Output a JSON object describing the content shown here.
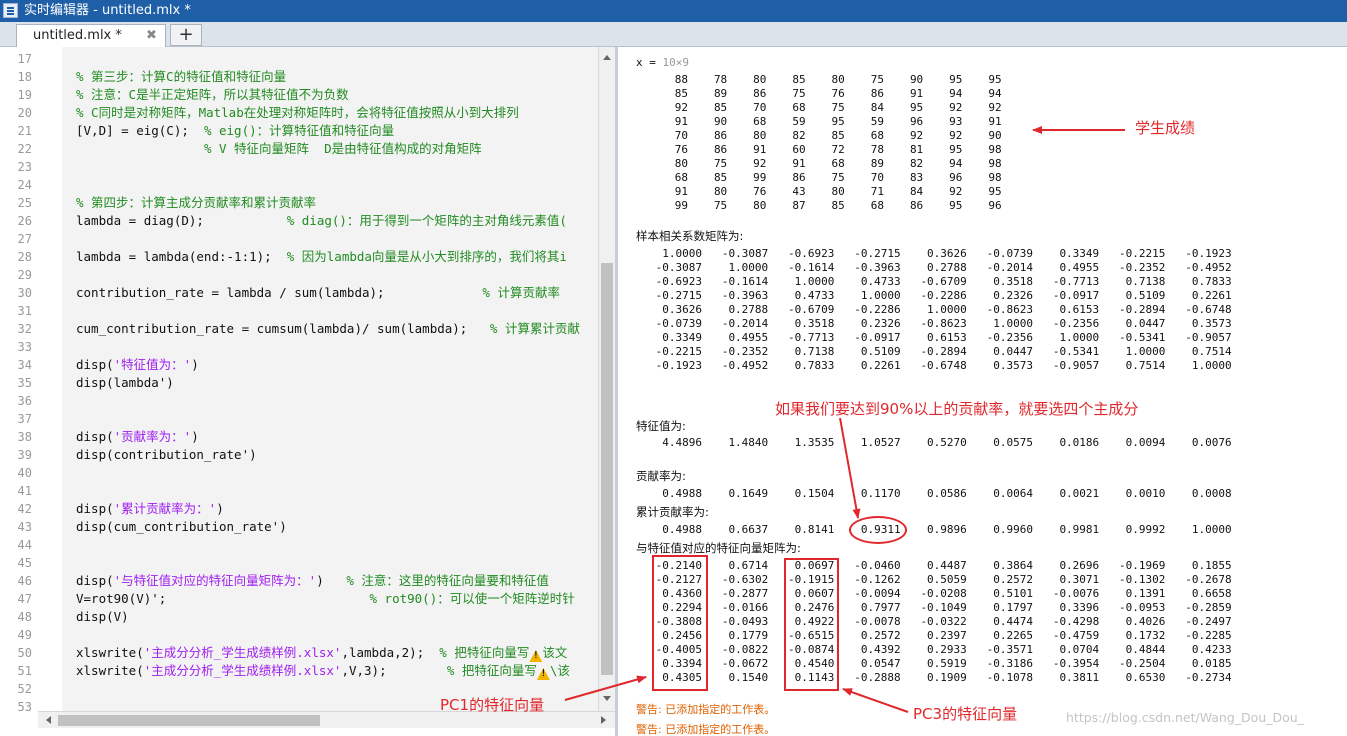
{
  "window": {
    "title": "实时编辑器 - untitled.mlx *"
  },
  "tabs": [
    {
      "label": "untitled.mlx *",
      "close": "✖"
    }
  ],
  "tab_add": "+",
  "editor": {
    "line_numbers": [
      "17",
      "18",
      "19",
      "20",
      "21",
      "22",
      "23",
      "24",
      "25",
      "26",
      "27",
      "28",
      "29",
      "30",
      "31",
      "32",
      "33",
      "34",
      "35",
      "36",
      "37",
      "38",
      "39",
      "40",
      "41",
      "42",
      "43",
      "44",
      "45",
      "46",
      "47",
      "48",
      "49",
      "50",
      "51",
      "52",
      "53"
    ],
    "lines": [
      {
        "n": 18,
        "parts": [
          {
            "t": "% 第三步：计算C的特征值和特征向量",
            "c": "comment"
          }
        ]
      },
      {
        "n": 19,
        "parts": [
          {
            "t": "% 注意：C是半正定矩阵，所以其特征值不为负数",
            "c": "comment"
          }
        ]
      },
      {
        "n": 20,
        "parts": [
          {
            "t": "% C同时是对称矩阵，Matlab在处理对称矩阵时，会将特征值按照从小到大排列",
            "c": "comment"
          }
        ]
      },
      {
        "n": 21,
        "parts": [
          {
            "t": "[V,D] = eig(C);  ",
            "c": ""
          },
          {
            "t": "% eig()：计算特征值和特征向量",
            "c": "comment"
          }
        ]
      },
      {
        "n": 22,
        "parts": [
          {
            "t": "                 ",
            "c": ""
          },
          {
            "t": "% V 特征向量矩阵  D是由特征值构成的对角矩阵",
            "c": "comment"
          }
        ]
      },
      {
        "n": 25,
        "parts": [
          {
            "t": "% 第四步：计算主成分贡献率和累计贡献率",
            "c": "comment"
          }
        ]
      },
      {
        "n": 26,
        "parts": [
          {
            "t": "lambda = diag(D);           ",
            "c": ""
          },
          {
            "t": "% diag()：用于得到一个矩阵的主对角线元素值(",
            "c": "comment"
          }
        ]
      },
      {
        "n": 28,
        "parts": [
          {
            "t": "lambda = lambda(end:-1:1);  ",
            "c": ""
          },
          {
            "t": "% 因为lambda向量是从小大到排序的，我们将其i",
            "c": "comment"
          }
        ]
      },
      {
        "n": 30,
        "parts": [
          {
            "t": "contribution_rate = lambda / sum(lambda);             ",
            "c": ""
          },
          {
            "t": "% 计算贡献率",
            "c": "comment"
          }
        ]
      },
      {
        "n": 32,
        "parts": [
          {
            "t": "cum_contribution_rate = cumsum(lambda)/ sum(lambda);   ",
            "c": ""
          },
          {
            "t": "% 计算累计贡献",
            "c": "comment"
          }
        ]
      },
      {
        "n": 34,
        "parts": [
          {
            "t": "disp(",
            "c": ""
          },
          {
            "t": "'特征值为：'",
            "c": "str"
          },
          {
            "t": ")",
            "c": ""
          }
        ]
      },
      {
        "n": 35,
        "parts": [
          {
            "t": "disp(lambda')",
            "c": ""
          }
        ]
      },
      {
        "n": 38,
        "parts": [
          {
            "t": "disp(",
            "c": ""
          },
          {
            "t": "'贡献率为：'",
            "c": "str"
          },
          {
            "t": ")",
            "c": ""
          }
        ]
      },
      {
        "n": 39,
        "parts": [
          {
            "t": "disp(contribution_rate')",
            "c": ""
          }
        ]
      },
      {
        "n": 42,
        "parts": [
          {
            "t": "disp(",
            "c": ""
          },
          {
            "t": "'累计贡献率为：'",
            "c": "str"
          },
          {
            "t": ")",
            "c": ""
          }
        ]
      },
      {
        "n": 43,
        "parts": [
          {
            "t": "disp(cum_contribution_rate')",
            "c": ""
          }
        ]
      },
      {
        "n": 46,
        "parts": [
          {
            "t": "disp(",
            "c": ""
          },
          {
            "t": "'与特征值对应的特征向量矩阵为：'",
            "c": "str"
          },
          {
            "t": ")   ",
            "c": ""
          },
          {
            "t": "% 注意：这里的特征向量要和特征值",
            "c": "comment"
          }
        ]
      },
      {
        "n": 47,
        "parts": [
          {
            "t": "V=rot90(V)';                           ",
            "c": ""
          },
          {
            "t": "% rot90()：可以使一个矩阵逆时针",
            "c": "comment"
          }
        ]
      },
      {
        "n": 48,
        "parts": [
          {
            "t": "disp(V)",
            "c": ""
          }
        ]
      },
      {
        "n": 50,
        "parts": [
          {
            "t": "xlswrite(",
            "c": ""
          },
          {
            "t": "'主成分分析_学生成绩样例.xlsx'",
            "c": "str"
          },
          {
            "t": ",lambda,2);  ",
            "c": ""
          },
          {
            "t": "% 把特征向量写",
            "c": "comment"
          },
          {
            "t": "!",
            "c": "warn"
          },
          {
            "t": "该文",
            "c": "comment"
          }
        ]
      },
      {
        "n": 51,
        "parts": [
          {
            "t": "xlswrite(",
            "c": ""
          },
          {
            "t": "'主成分分析_学生成绩样例.xlsx'",
            "c": "str"
          },
          {
            "t": ",V,3);        ",
            "c": ""
          },
          {
            "t": "% 把特征向量写",
            "c": "comment"
          },
          {
            "t": "!",
            "c": "warn"
          },
          {
            "t": "\\该",
            "c": "comment"
          }
        ]
      }
    ]
  },
  "output": {
    "x_label": "x = ",
    "x_size": "10×9",
    "x_rows": [
      [
        "88",
        "78",
        "80",
        "85",
        "80",
        "75",
        "90",
        "95",
        "95"
      ],
      [
        "85",
        "89",
        "86",
        "75",
        "76",
        "86",
        "91",
        "94",
        "94"
      ],
      [
        "92",
        "85",
        "70",
        "68",
        "75",
        "84",
        "95",
        "92",
        "92"
      ],
      [
        "91",
        "90",
        "68",
        "59",
        "95",
        "59",
        "96",
        "93",
        "91"
      ],
      [
        "70",
        "86",
        "80",
        "82",
        "85",
        "68",
        "92",
        "92",
        "90"
      ],
      [
        "76",
        "86",
        "91",
        "60",
        "72",
        "78",
        "81",
        "95",
        "98"
      ],
      [
        "80",
        "75",
        "92",
        "91",
        "68",
        "89",
        "82",
        "94",
        "98"
      ],
      [
        "68",
        "85",
        "99",
        "86",
        "75",
        "70",
        "83",
        "96",
        "98"
      ],
      [
        "91",
        "80",
        "76",
        "43",
        "80",
        "71",
        "84",
        "92",
        "95"
      ],
      [
        "99",
        "75",
        "80",
        "87",
        "85",
        "68",
        "86",
        "95",
        "96"
      ]
    ],
    "corr_label": "样本相关系数矩阵为:",
    "corr_rows": [
      [
        "1.0000",
        "-0.3087",
        "-0.6923",
        "-0.2715",
        "0.3626",
        "-0.0739",
        "0.3349",
        "-0.2215",
        "-0.1923"
      ],
      [
        "-0.3087",
        "1.0000",
        "-0.1614",
        "-0.3963",
        "0.2788",
        "-0.2014",
        "0.4955",
        "-0.2352",
        "-0.4952"
      ],
      [
        "-0.6923",
        "-0.1614",
        "1.0000",
        "0.4733",
        "-0.6709",
        "0.3518",
        "-0.7713",
        "0.7138",
        "0.7833"
      ],
      [
        "-0.2715",
        "-0.3963",
        "0.4733",
        "1.0000",
        "-0.2286",
        "0.2326",
        "-0.0917",
        "0.5109",
        "0.2261"
      ],
      [
        "0.3626",
        "0.2788",
        "-0.6709",
        "-0.2286",
        "1.0000",
        "-0.8623",
        "0.6153",
        "-0.2894",
        "-0.6748"
      ],
      [
        "-0.0739",
        "-0.2014",
        "0.3518",
        "0.2326",
        "-0.8623",
        "1.0000",
        "-0.2356",
        "0.0447",
        "0.3573"
      ],
      [
        "0.3349",
        "0.4955",
        "-0.7713",
        "-0.0917",
        "0.6153",
        "-0.2356",
        "1.0000",
        "-0.5341",
        "-0.9057"
      ],
      [
        "-0.2215",
        "-0.2352",
        "0.7138",
        "0.5109",
        "-0.2894",
        "0.0447",
        "-0.5341",
        "1.0000",
        "0.7514"
      ],
      [
        "-0.1923",
        "-0.4952",
        "0.7833",
        "0.2261",
        "-0.6748",
        "0.3573",
        "-0.9057",
        "0.7514",
        "1.0000"
      ]
    ],
    "eig_label": "特征值为:",
    "eig_values": [
      "4.4896",
      "1.4840",
      "1.3535",
      "1.0527",
      "0.5270",
      "0.0575",
      "0.0186",
      "0.0094",
      "0.0076"
    ],
    "contrib_label": "贡献率为:",
    "contrib_values": [
      "0.4988",
      "0.1649",
      "0.1504",
      "0.1170",
      "0.0586",
      "0.0064",
      "0.0021",
      "0.0010",
      "0.0008"
    ],
    "cum_label": "累计贡献率为:",
    "cum_values": [
      "0.4988",
      "0.6637",
      "0.8141",
      "0.9311",
      "0.9896",
      "0.9960",
      "0.9981",
      "0.9992",
      "1.0000"
    ],
    "vec_label": "与特征值对应的特征向量矩阵为:",
    "vec_rows": [
      [
        "-0.2140",
        "0.6714",
        "0.0697",
        "-0.0460",
        "0.4487",
        "0.3864",
        "0.2696",
        "-0.1969",
        "0.1855"
      ],
      [
        "-0.2127",
        "-0.6302",
        "-0.1915",
        "-0.1262",
        "0.5059",
        "0.2572",
        "0.3071",
        "-0.1302",
        "-0.2678"
      ],
      [
        "0.4360",
        "-0.2877",
        "0.0607",
        "-0.0094",
        "-0.0208",
        "0.5101",
        "-0.0076",
        "0.1391",
        "0.6658"
      ],
      [
        "0.2294",
        "-0.0166",
        "0.2476",
        "0.7977",
        "-0.1049",
        "0.1797",
        "0.3396",
        "-0.0953",
        "-0.2859"
      ],
      [
        "-0.3808",
        "-0.0493",
        "0.4922",
        "-0.0078",
        "-0.0322",
        "0.4474",
        "-0.4298",
        "0.4026",
        "-0.2497"
      ],
      [
        "0.2456",
        "0.1779",
        "-0.6515",
        "0.2572",
        "0.2397",
        "0.2265",
        "-0.4759",
        "0.1732",
        "-0.2285"
      ],
      [
        "-0.4005",
        "-0.0822",
        "-0.0874",
        "0.4392",
        "0.2933",
        "-0.3571",
        "0.0704",
        "0.4844",
        "0.4233"
      ],
      [
        "0.3394",
        "-0.0672",
        "0.4540",
        "0.0547",
        "0.5919",
        "-0.3186",
        "-0.3954",
        "-0.2504",
        "0.0185"
      ],
      [
        "0.4305",
        "0.1540",
        "0.1143",
        "-0.2888",
        "0.1909",
        "-0.1078",
        "0.3811",
        "0.6530",
        "-0.2734"
      ]
    ],
    "warnings": [
      "警告: 已添加指定的工作表。",
      "警告: 已添加指定的工作表。"
    ]
  },
  "annotations": {
    "student_scores": "学生成绩",
    "ninety_percent": "如果我们要达到90%以上的贡献率，就要选四个主成分",
    "pc1": "PC1的特征向量",
    "pc3": "PC3的特征向量",
    "color": "#e0282c"
  },
  "watermark": "https://blog.csdn.net/Wang_Dou_Dou_",
  "colors": {
    "titlebar": "#1f5fa8",
    "comment": "#228b22",
    "string": "#a020f0",
    "warning_text": "#e06000",
    "annotation": "#e0282c"
  }
}
